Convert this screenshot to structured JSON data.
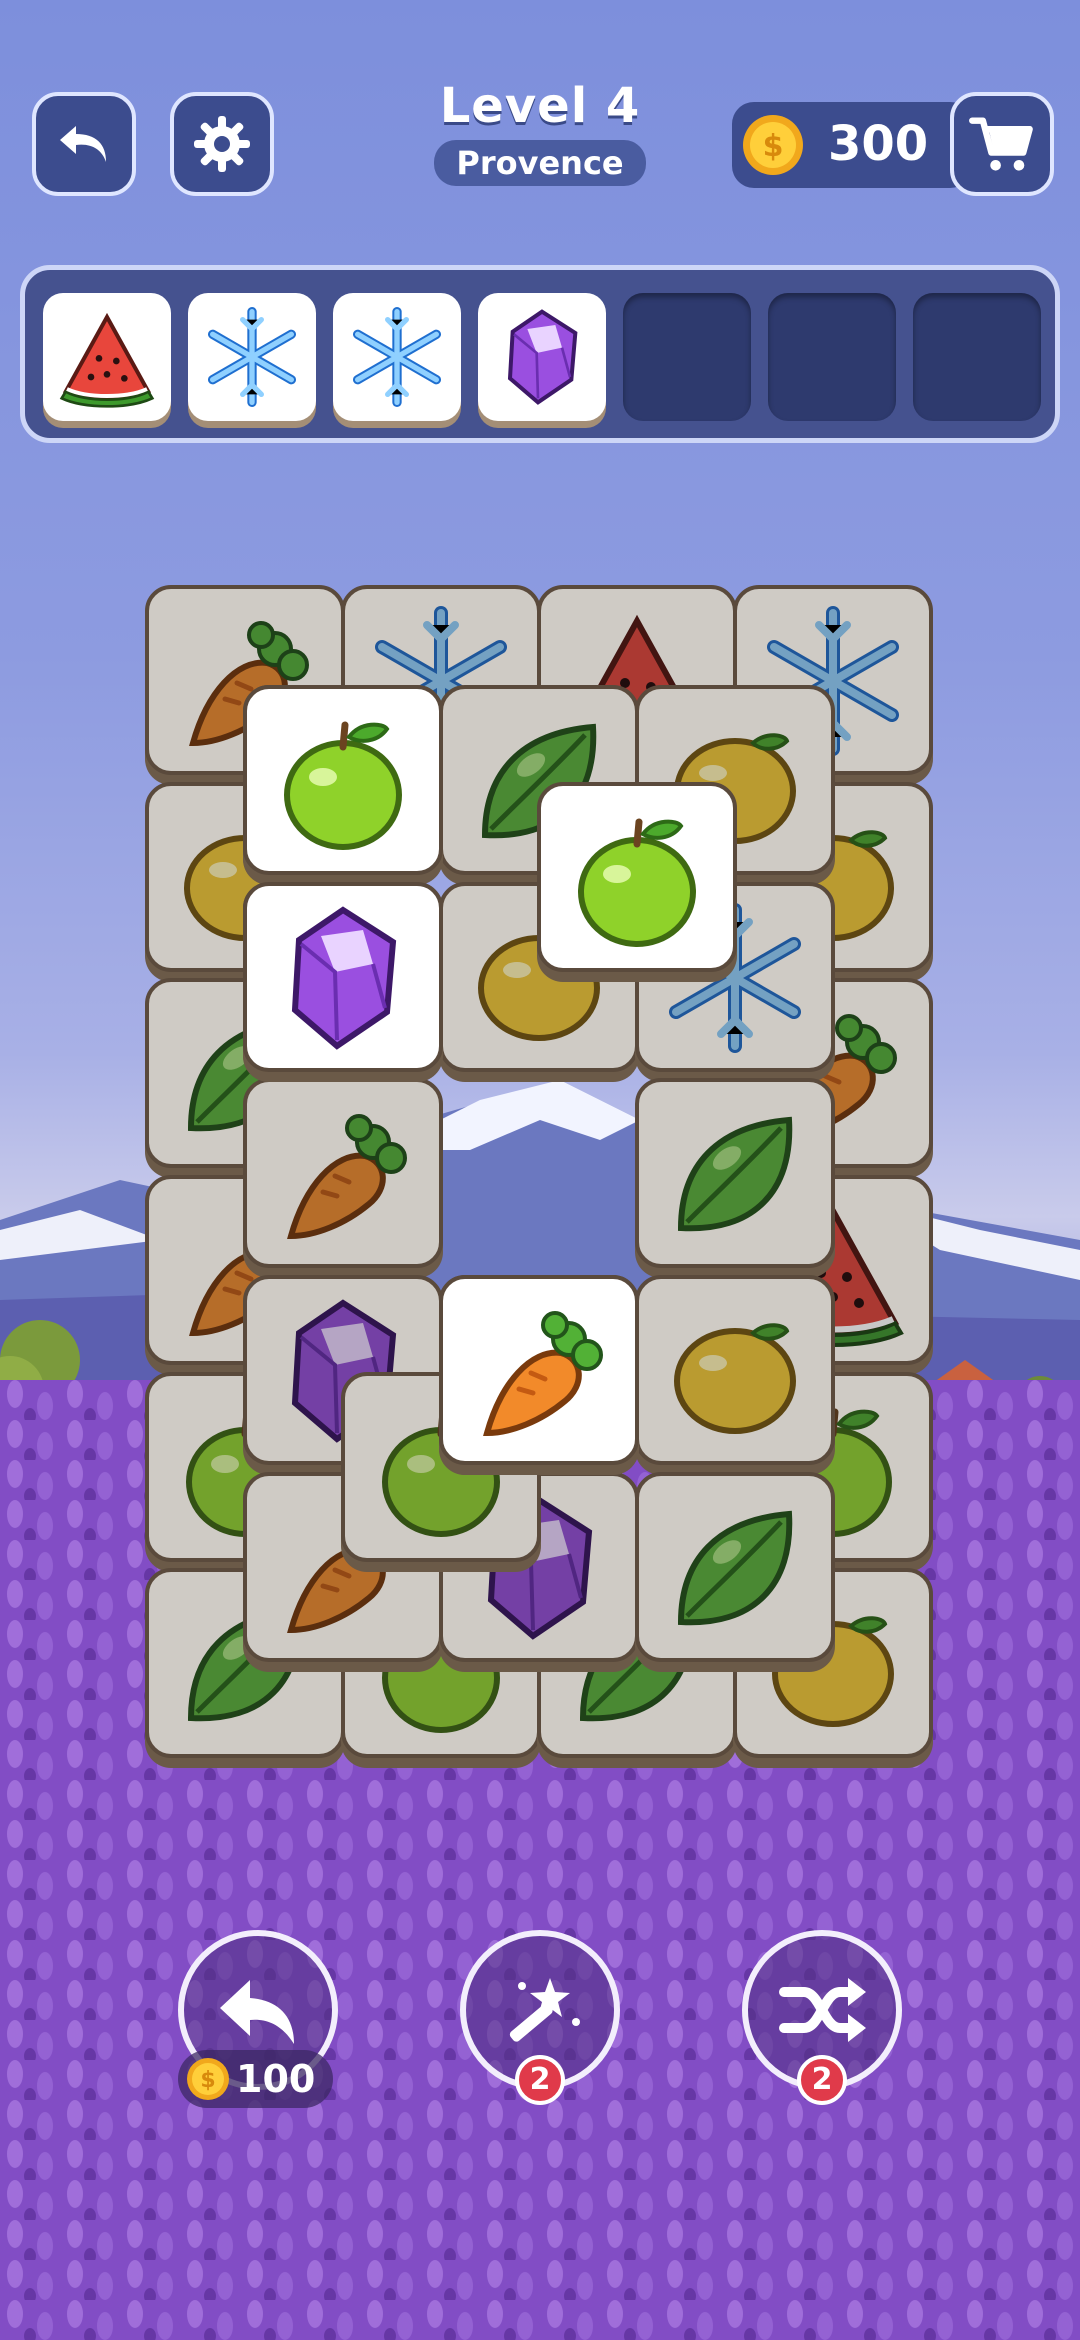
{
  "header": {
    "level_title": "Level 4",
    "level_subtitle": "Provence",
    "coins": "300"
  },
  "tray": {
    "capacity": 7,
    "slots": [
      "watermelon",
      "snowflake",
      "snowflake",
      "gem",
      "",
      "",
      ""
    ]
  },
  "board": {
    "dim_tiles": [
      "carrot",
      "snowflake",
      "watermelon",
      "snowflake",
      "lemon",
      "lemon",
      "leaf",
      "carrot",
      "carrot",
      "watermelon",
      "apple",
      "apple",
      "leaf",
      "apple",
      "leaf",
      "lemon",
      "watermelon",
      "leaf",
      "lemon",
      "apple",
      "lemon",
      "snowflake",
      "carrot",
      "leaf",
      "gem",
      "lemon",
      "carrot",
      "gem",
      "leaf",
      "apple",
      "leaf"
    ],
    "bright_tiles": [
      "apple",
      "gem",
      "apple",
      "carrot"
    ]
  },
  "powerups": {
    "undo_cost": "100",
    "magic_count": "2",
    "shuffle_count": "2"
  },
  "colors": {
    "panel": "#3c4c8e",
    "tray": "#45528f",
    "badge": "#e03a4a",
    "tile_dim": "#cfcbc5",
    "tile_bright": "#ffffff"
  }
}
